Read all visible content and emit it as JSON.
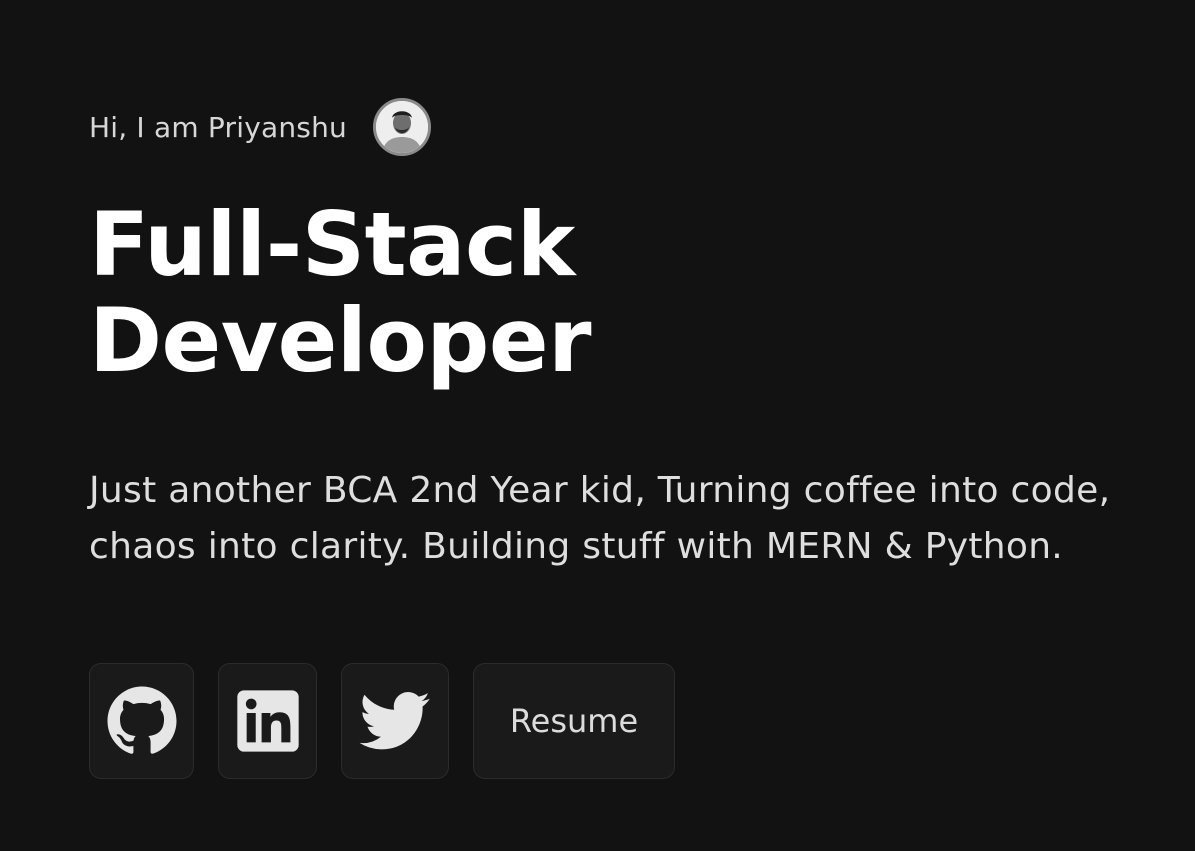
{
  "hero": {
    "greeting": "Hi, I am Priyanshu",
    "headline_line1": "Full-Stack",
    "headline_line2": "Developer",
    "bio": "Just another BCA 2nd Year kid, Turning coffee into code, chaos into clarity. Building stuff with MERN & Python."
  },
  "links": {
    "github_icon": "github-icon",
    "linkedin_icon": "linkedin-icon",
    "twitter_icon": "twitter-icon",
    "resume_label": "Resume"
  },
  "colors": {
    "background": "#121212",
    "button_bg": "#1a1a1a",
    "text": "#ffffff",
    "muted_text": "#dedede"
  }
}
